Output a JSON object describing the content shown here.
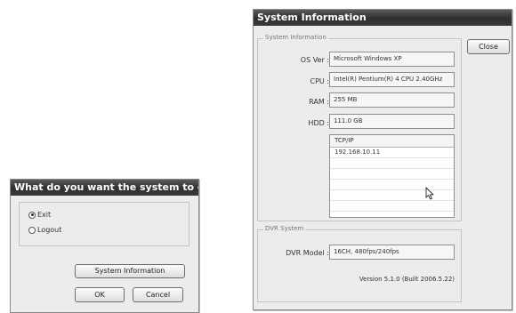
{
  "exit_dialog": {
    "question": "What do you want the system to do?",
    "options": [
      {
        "label": "Exit",
        "selected": true
      },
      {
        "label": "Logout",
        "selected": false
      }
    ],
    "sysinfo_button": "System Information",
    "ok_button": "OK",
    "cancel_button": "Cancel"
  },
  "sysinfo_dialog": {
    "title": "System Information",
    "close_button": "Close",
    "group1_title": "System Information",
    "os_label": "OS Ver :",
    "os_value": "Microsoft Windows XP",
    "cpu_label": "CPU :",
    "cpu_value": "Intel(R) Pentium(R) 4 CPU 2.40GHz",
    "ram_label": "RAM :",
    "ram_value": "255 MB",
    "hdd_label": "HDD :",
    "hdd_value": "111.0 GB",
    "tcpip_header": "TCP/IP",
    "tcpip_rows": [
      "192.168.10.11",
      "",
      "",
      "",
      "",
      "",
      ""
    ],
    "group2_title": "DVR System",
    "dvr_model_label": "DVR Model :",
    "dvr_model_value": "16CH, 480fps/240fps",
    "version": "Version 5.1.0 (Built 2006.5.22)"
  }
}
